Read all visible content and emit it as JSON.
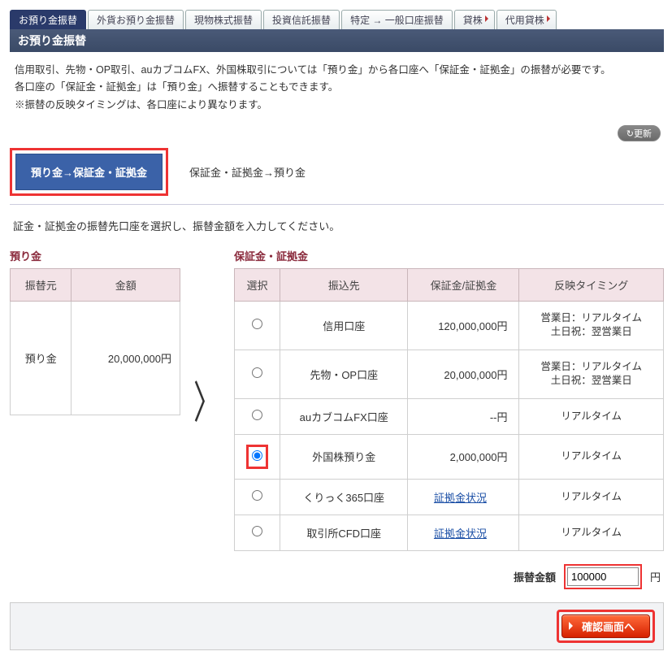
{
  "tabs": [
    "お預り金振替",
    "外貨お預り金振替",
    "現物株式振替",
    "投資信託振替",
    "特定 → 一般口座振替",
    "貸株",
    "代用貸株"
  ],
  "active_tab_index": 0,
  "bar_title": "お預り金振替",
  "lead": [
    "信用取引、先物・OP取引、auカブコムFX、外国株取引については「預り金」から各口座へ「保証金・証拠金」の振替が必要です。",
    "各口座の「保証金・証拠金」は「預り金」へ振替することもできます。",
    "※振替の反映タイミングは、各口座により異なります。"
  ],
  "update_label": "↻更新",
  "modes": {
    "active": "預り金→保証金・証拠金",
    "inactive": "保証金・証拠金→預り金"
  },
  "instruction": "証金・証拠金の振替先口座を選択し、振替金額を入力してください。",
  "src": {
    "title": "預り金",
    "th": [
      "振替元",
      "金額"
    ],
    "row": {
      "label": "預り金",
      "amount": "20,000,000円"
    }
  },
  "dst": {
    "title": "保証金・証拠金",
    "th": [
      "選択",
      "振込先",
      "保証金/証拠金",
      "反映タイミング"
    ],
    "rows": [
      {
        "dest": "信用口座",
        "margin": "120,000,000円",
        "timing": "営業日：リアルタイム\n土日祝：翌営業日",
        "is_link": false,
        "selected": false
      },
      {
        "dest": "先物・OP口座",
        "margin": "20,000,000円",
        "timing": "営業日：リアルタイム\n土日祝：翌営業日",
        "is_link": false,
        "selected": false
      },
      {
        "dest": "auカブコムFX口座",
        "margin": "--円",
        "timing": "リアルタイム",
        "is_link": false,
        "selected": false
      },
      {
        "dest": "外国株預り金",
        "margin": "2,000,000円",
        "timing": "リアルタイム",
        "is_link": false,
        "selected": true
      },
      {
        "dest": "くりっく365口座",
        "margin": "証拠金状況",
        "timing": "リアルタイム",
        "is_link": true,
        "selected": false
      },
      {
        "dest": "取引所CFD口座",
        "margin": "証拠金状況",
        "timing": "リアルタイム",
        "is_link": true,
        "selected": false
      }
    ]
  },
  "amount": {
    "label": "振替金額",
    "value": "100000",
    "unit": "円"
  },
  "confirm_label": "確認画面へ"
}
